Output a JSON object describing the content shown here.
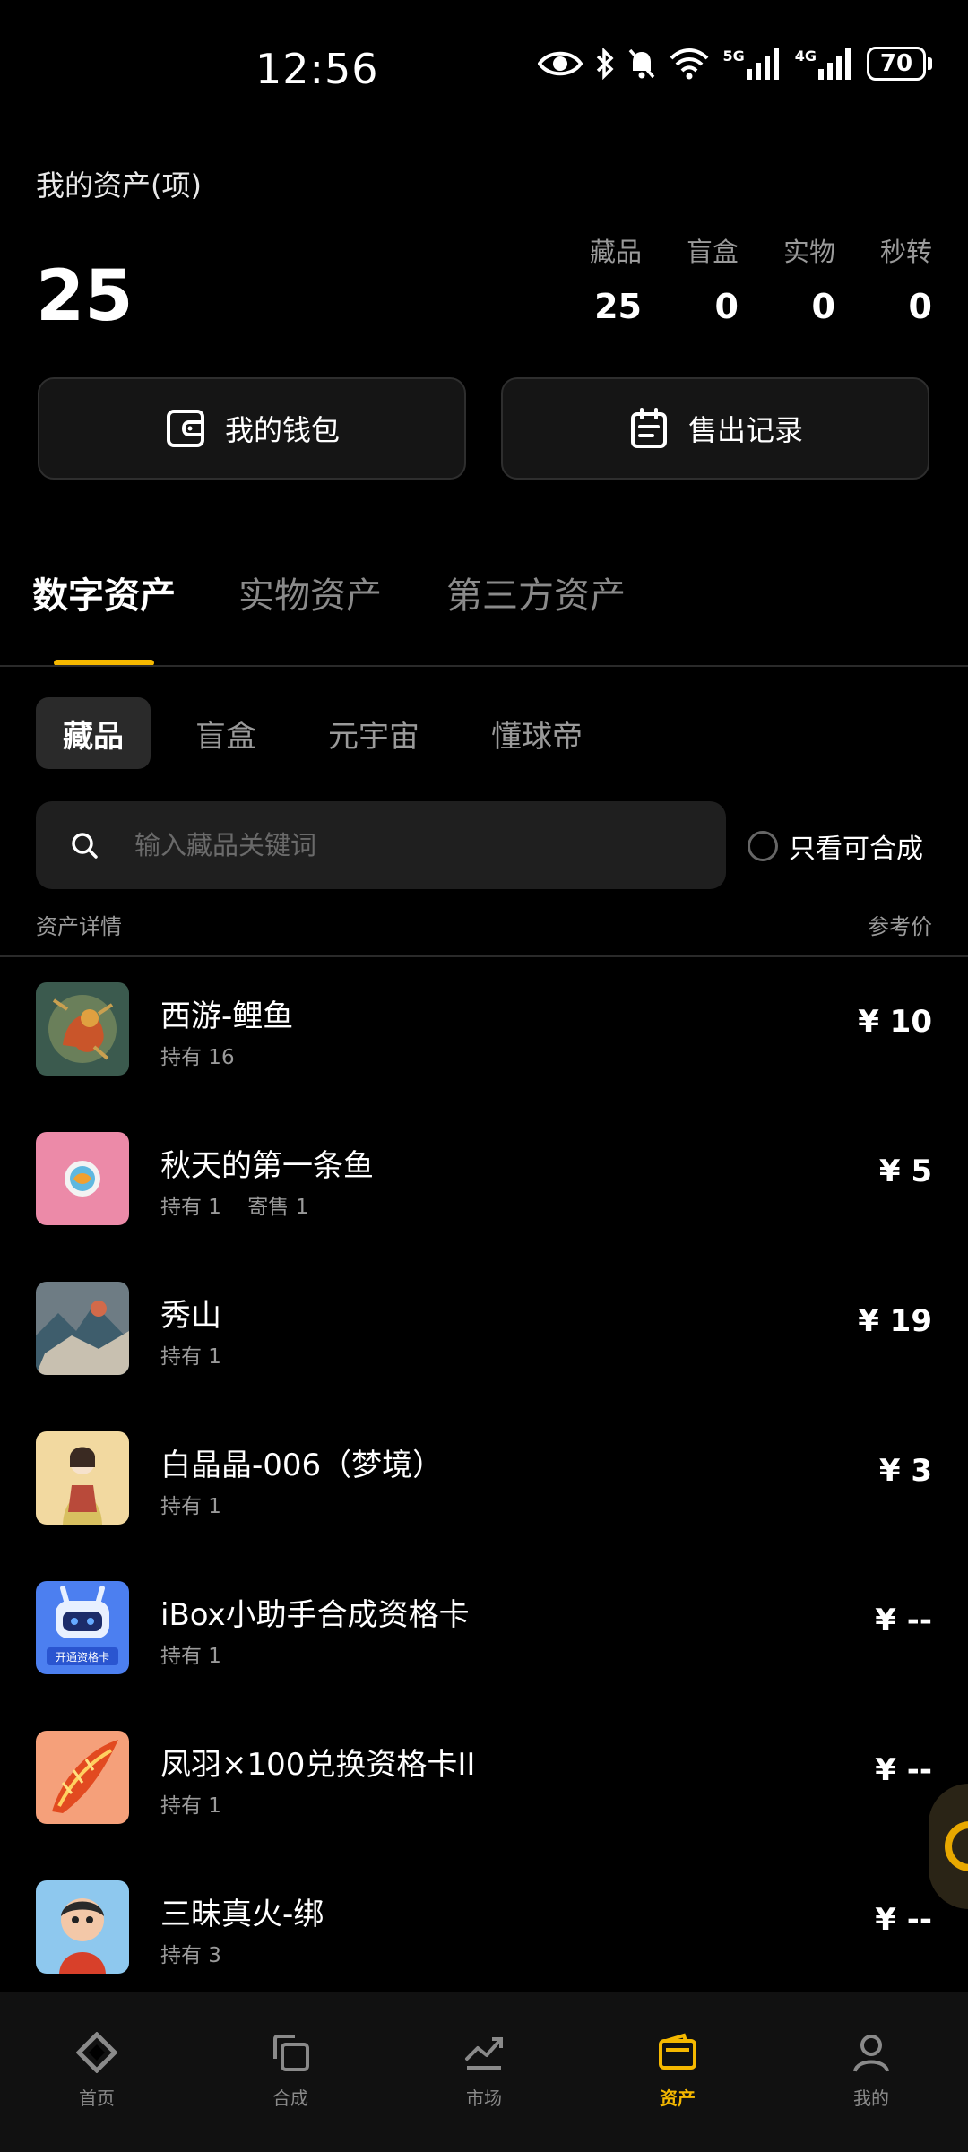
{
  "status": {
    "time": "12:56",
    "battery": "70",
    "net1": "5G",
    "net2": "4G"
  },
  "summary": {
    "label": "我的资产(项)",
    "total": "25",
    "stats": [
      {
        "label": "藏品",
        "value": "25"
      },
      {
        "label": "盲盒",
        "value": "0"
      },
      {
        "label": "实物",
        "value": "0"
      },
      {
        "label": "秒转",
        "value": "0"
      }
    ]
  },
  "actions": {
    "wallet": "我的钱包",
    "sales": "售出记录"
  },
  "main_tabs": [
    "数字资产",
    "实物资产",
    "第三方资产"
  ],
  "sub_tabs": [
    "藏品",
    "盲盒",
    "元宇宙",
    "懂球帝"
  ],
  "search": {
    "placeholder": "输入藏品关键词"
  },
  "filter": {
    "label": "只看可合成"
  },
  "list_header": {
    "left": "资产详情",
    "right": "参考价"
  },
  "assets": [
    {
      "name": "西游-鲤鱼",
      "meta": [
        "持有 16"
      ],
      "price": "¥ 10"
    },
    {
      "name": "秋天的第一条鱼",
      "meta": [
        "持有 1",
        "寄售 1"
      ],
      "price": "¥ 5"
    },
    {
      "name": "秀山",
      "meta": [
        "持有 1"
      ],
      "price": "¥ 19"
    },
    {
      "name": "白晶晶-006（梦境）",
      "meta": [
        "持有 1"
      ],
      "price": "¥ 3"
    },
    {
      "name": "iBox小助手合成资格卡",
      "meta": [
        "持有 1"
      ],
      "price": "¥ --",
      "thumb_text": "开通资格卡"
    },
    {
      "name": "凤羽×100兑换资格卡II",
      "meta": [
        "持有 1"
      ],
      "price": "¥ --"
    },
    {
      "name": "三昧真火-绑",
      "meta": [
        "持有 3"
      ],
      "price": "¥ --"
    }
  ],
  "bottom_nav": [
    {
      "label": "首页",
      "icon": "diamond-icon"
    },
    {
      "label": "合成",
      "icon": "compose-icon"
    },
    {
      "label": "市场",
      "icon": "trend-icon"
    },
    {
      "label": "资产",
      "icon": "wallet-icon"
    },
    {
      "label": "我的",
      "icon": "person-icon"
    }
  ],
  "colors": {
    "accent": "#f5b800",
    "background": "#000000",
    "card": "#151515"
  }
}
